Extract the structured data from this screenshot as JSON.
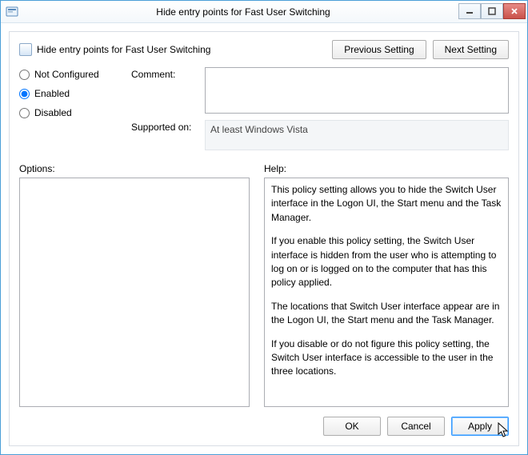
{
  "titlebar": {
    "title": "Hide entry points for Fast User Switching"
  },
  "policy": {
    "name": "Hide entry points for Fast User Switching"
  },
  "nav": {
    "previous": "Previous Setting",
    "next": "Next Setting"
  },
  "radios": {
    "not_configured": "Not Configured",
    "enabled": "Enabled",
    "disabled": "Disabled",
    "selected": "enabled"
  },
  "fields": {
    "comment_label": "Comment:",
    "comment_value": "",
    "supported_label": "Supported on:",
    "supported_value": "At least Windows Vista"
  },
  "labels": {
    "options": "Options:",
    "help": "Help:"
  },
  "help": {
    "p1": "This policy setting allows you to hide the Switch User interface in the Logon UI, the Start menu and the Task Manager.",
    "p2": "If you enable this policy setting, the Switch User interface is hidden from the user who is attempting to log on or is logged on to the computer that has this policy applied.",
    "p3": "The locations that Switch User interface appear are in the Logon UI, the Start menu and the Task Manager.",
    "p4": "If you disable or do not figure this policy setting, the Switch User interface is accessible to the user in the three locations."
  },
  "footer": {
    "ok": "OK",
    "cancel": "Cancel",
    "apply": "Apply"
  }
}
